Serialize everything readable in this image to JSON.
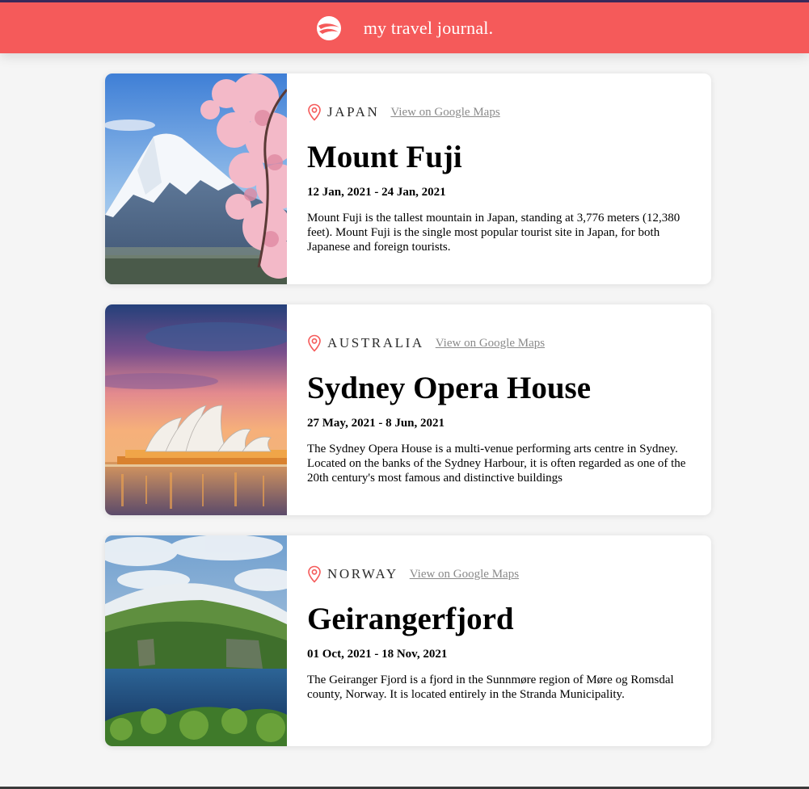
{
  "header": {
    "title": "my travel journal.",
    "logo_icon": "globe-icon",
    "background": "#f55a5a"
  },
  "entries": [
    {
      "country": "JAPAN",
      "maps_link": "View on Google Maps",
      "title": "Mount Fuji",
      "dates": "12 Jan, 2021 - 24 Jan, 2021",
      "description": "Mount Fuji is the tallest mountain in Japan, standing at 3,776 meters (12,380 feet). Mount Fuji is the single most popular tourist site in Japan, for both Japanese and foreign tourists."
    },
    {
      "country": "AUSTRALIA",
      "maps_link": "View on Google Maps",
      "title": "Sydney Opera House",
      "dates": "27 May, 2021 - 8 Jun, 2021",
      "description": "The Sydney Opera House is a multi-venue performing arts centre in Sydney. Located on the banks of the Sydney Harbour, it is often regarded as one of the 20th century's most famous and distinctive buildings"
    },
    {
      "country": "NORWAY",
      "maps_link": "View on Google Maps",
      "title": "Geirangerfjord",
      "dates": "01 Oct, 2021 - 18 Nov, 2021",
      "description": "The Geiranger Fjord is a fjord in the Sunnmøre region of Møre og Romsdal county, Norway. It is located entirely in the Stranda Municipality."
    }
  ],
  "icons": {
    "location": "map-pin-icon"
  },
  "colors": {
    "accent": "#f55a5a",
    "link": "#8a8a8a"
  }
}
